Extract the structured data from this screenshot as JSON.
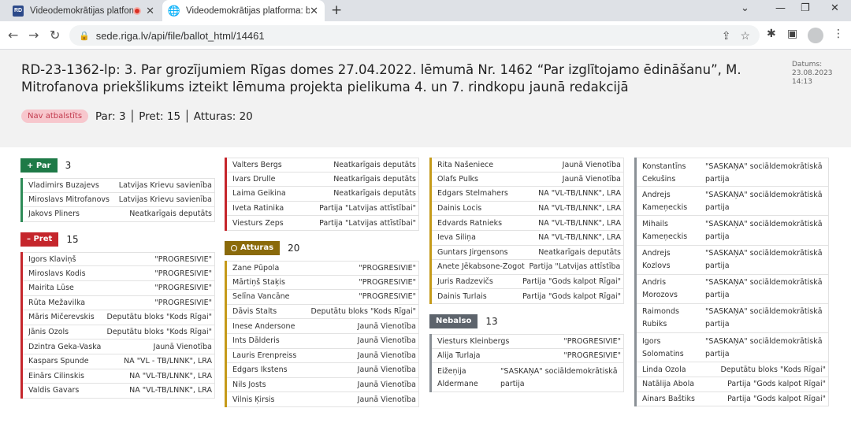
{
  "browser": {
    "tabs": [
      {
        "favicon": "RD",
        "title": "Videodemokrātijas platforma"
      },
      {
        "favicon": "globe-icon",
        "title": "Videodemokrātijas platforma: ba"
      }
    ],
    "url": "sede.riga.lv/api/file/ballot_html/14461"
  },
  "page": {
    "title": "RD-23-1362-lp: 3. Par grozījumiem Rīgas domes 27.04.2022. lēmumā Nr. 1462 “Par izglītojamo ēdināšanu”, M. Mitrofanova priekšlikums izteikt lēmuma projekta pielikuma 4. un 7. rindkopu jaunā redakcijā",
    "date_label": "Datums:",
    "date": "23.08.2023",
    "time": "14:13",
    "status": "Nav atbalstīts",
    "summary": "Par: 3 │ Pret: 15 │ Atturas: 20"
  },
  "groups": {
    "par": {
      "label": "+ Par",
      "count": "3",
      "members": [
        {
          "name": "Vladimirs Buzajevs",
          "party": "Latvijas Krievu savienība"
        },
        {
          "name": "Miroslavs Mitrofanovs",
          "party": "Latvijas Krievu savienība"
        },
        {
          "name": "Jakovs Pliners",
          "party": "Neatkarīgais deputāts"
        }
      ]
    },
    "pret": {
      "label": "– Pret",
      "count": "15",
      "members": [
        {
          "name": "Igors Klaviņš",
          "party": "\"PROGRESĪVIE\""
        },
        {
          "name": "Miroslavs Kodis",
          "party": "\"PROGRESĪVIE\""
        },
        {
          "name": "Mairita Lūse",
          "party": "\"PROGRESĪVIE\""
        },
        {
          "name": "Rūta Mežavilka",
          "party": "\"PROGRESĪVIE\""
        },
        {
          "name": "Māris Mičerevskis",
          "party": "Deputātu bloks \"Kods Rīgai\""
        },
        {
          "name": "Jānis Ozols",
          "party": "Deputātu bloks \"Kods Rīgai\""
        },
        {
          "name": "Dzintra Geka-Vaska",
          "party": "Jaunā Vienotība"
        },
        {
          "name": "Kaspars Spunde",
          "party": "NA \"VL - TB/LNNK\", LRA"
        },
        {
          "name": "Einārs Cilinskis",
          "party": "NA \"VL-TB/LNNK\", LRA"
        },
        {
          "name": "Valdis Gavars",
          "party": "NA \"VL-TB/LNNK\", LRA"
        },
        {
          "name": "Valters Bergs",
          "party": "Neatkarīgais deputāts"
        },
        {
          "name": "Ivars Drulle",
          "party": "Neatkarīgais deputāts"
        },
        {
          "name": "Laima Geikina",
          "party": "Neatkarīgais deputāts"
        },
        {
          "name": "Iveta Ratinika",
          "party": "Partija \"Latvijas attīstībai\""
        },
        {
          "name": "Viesturs Zeps",
          "party": "Partija \"Latvijas attīstībai\""
        }
      ]
    },
    "atturas": {
      "label": "Atturas",
      "count": "20",
      "members": [
        {
          "name": "Zane Pūpola",
          "party": "\"PROGRESĪVIE\""
        },
        {
          "name": "Mārtiņš Staķis",
          "party": "\"PROGRESĪVIE\""
        },
        {
          "name": "Selīna Vancāne",
          "party": "\"PROGRESĪVIE\""
        },
        {
          "name": "Dāvis Stalts",
          "party": "Deputātu bloks \"Kods Rīgai\""
        },
        {
          "name": "Inese Andersone",
          "party": "Jaunā Vienotība"
        },
        {
          "name": "Ints Dālderis",
          "party": "Jaunā Vienotība"
        },
        {
          "name": "Lauris Ērenpreiss",
          "party": "Jaunā Vienotība"
        },
        {
          "name": "Edgars Ikstens",
          "party": "Jaunā Vienotība"
        },
        {
          "name": "Nils Josts",
          "party": "Jaunā Vienotība"
        },
        {
          "name": "Vilnis Ķirsis",
          "party": "Jaunā Vienotība"
        },
        {
          "name": "Rita Našeniece",
          "party": "Jaunā Vienotība"
        },
        {
          "name": "Olafs Pulks",
          "party": "Jaunā Vienotība"
        },
        {
          "name": "Edgars Štelmahers",
          "party": "NA \"VL-TB/LNNK\", LRA"
        },
        {
          "name": "Dainis Locis",
          "party": "NA \"VL-TB/LNNK\", LRA"
        },
        {
          "name": "Edvards Ratnieks",
          "party": "NA \"VL-TB/LNNK\", LRA"
        },
        {
          "name": "Ieva Siliņa",
          "party": "NA \"VL-TB/LNNK\", LRA"
        },
        {
          "name": "Guntars Jirgensons",
          "party": "Neatkarīgais deputāts"
        },
        {
          "name": "Anete Jēkabsone-Žogota",
          "party": "Partija \"Latvijas attīstībai\""
        },
        {
          "name": "Juris Radzevičs",
          "party": "Partija \"Gods kalpot Rīgai\""
        },
        {
          "name": "Dainis Turlais",
          "party": "Partija \"Gods kalpot Rīgai\""
        }
      ]
    },
    "nebalso": {
      "label": "Nebalso",
      "count": "13",
      "members": [
        {
          "name": "Viesturs Kleinbergs",
          "party": "\"PROGRESĪVIE\""
        },
        {
          "name": "Alija Turlaja",
          "party": "\"PROGRESĪVIE\""
        },
        {
          "name": "Eižeņija Aldermane",
          "party": "\"SASKAŅA\" sociāldemokrātiskā partija",
          "name_l1": "Eižeņija",
          "name_l2": "Aldermane",
          "party_l1": "\"SASKAŅA\" sociāldemokrātiskā",
          "party_l2": "partija"
        },
        {
          "name": "Konstantīns Čekušins",
          "name_l1": "Konstantīns",
          "name_l2": "Čekušins",
          "party_l1": "\"SASKAŅA\" sociāldemokrātiskā",
          "party_l2": "partija"
        },
        {
          "name": "Andrejs Kameņeckis",
          "name_l1": "Andrejs",
          "name_l2": "Kameņeckis",
          "party_l1": "\"SASKAŅA\" sociāldemokrātiskā",
          "party_l2": "partija"
        },
        {
          "name": "Mihails Kameņeckis",
          "name_l1": "Mihails",
          "name_l2": "Kameņeckis",
          "party_l1": "\"SASKAŅA\" sociāldemokrātiskā",
          "party_l2": "partija"
        },
        {
          "name": "Andrejs Kozlovs",
          "name_l1": "Andrejs",
          "name_l2": "Kozlovs",
          "party_l1": "\"SASKAŅA\" sociāldemokrātiskā",
          "party_l2": "partija"
        },
        {
          "name": "Andris Morozovs",
          "name_l1": "Andris",
          "name_l2": "Morozovs",
          "party_l1": "\"SASKAŅA\" sociāldemokrātiskā",
          "party_l2": "partija"
        },
        {
          "name": "Raimonds Rubiks",
          "name_l1": "Raimonds",
          "name_l2": "Rubiks",
          "party_l1": "\"SASKAŅA\" sociāldemokrātiskā",
          "party_l2": "partija"
        },
        {
          "name": "Igors Solomatins",
          "name_l1": "Igors",
          "name_l2": "Solomatins",
          "party_l1": "\"SASKAŅA\" sociāldemokrātiskā",
          "party_l2": "partija"
        },
        {
          "name": "Linda Ozola",
          "party": "Deputātu bloks \"Kods Rīgai\""
        },
        {
          "name": "Natālija Ābola",
          "party": "Partija \"Gods kalpot Rīgai\""
        },
        {
          "name": "Ainars Baštiks",
          "party": "Partija \"Gods kalpot Rīgai\""
        }
      ]
    }
  }
}
